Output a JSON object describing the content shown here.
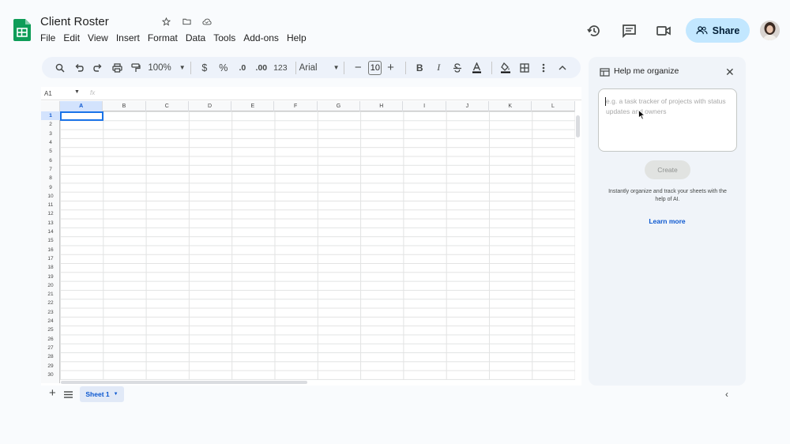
{
  "app": {
    "title": "Client Roster",
    "brand_color": "#0f9d58"
  },
  "menu": [
    "File",
    "Edit",
    "View",
    "Insert",
    "Format",
    "Data",
    "Tools",
    "Add-ons",
    "Help"
  ],
  "header": {
    "share_label": "Share",
    "icons": [
      "history-icon",
      "comment-icon",
      "meet-icon"
    ]
  },
  "toolbar": {
    "zoom": "100%",
    "currency": "$",
    "percent": "%",
    "decrease_decimal": ".0",
    "increase_decimal": ".00",
    "number_format": "123",
    "font": "Arial",
    "font_size": "10",
    "bold": "B",
    "italic": "I"
  },
  "sheet": {
    "name_box": "A1",
    "fx": "fx",
    "columns": [
      "A",
      "B",
      "C",
      "D",
      "E",
      "F",
      "G",
      "H",
      "I",
      "J",
      "K",
      "L"
    ],
    "rows": [
      "1",
      "2",
      "3",
      "4",
      "5",
      "6",
      "7",
      "8",
      "9",
      "10",
      "11",
      "12",
      "13",
      "14",
      "15",
      "16",
      "17",
      "18",
      "19",
      "20",
      "21",
      "22",
      "23",
      "24",
      "25",
      "26",
      "27",
      "28",
      "29",
      "30"
    ],
    "active_tab": "Sheet 1"
  },
  "panel": {
    "title": "Help me organize",
    "prompt_placeholder": "e.g. a task tracker of projects with status updates and owners",
    "create_label": "Create",
    "description": "Instantly organize and track your sheets with the help of AI.",
    "learn_more": "Learn more"
  }
}
